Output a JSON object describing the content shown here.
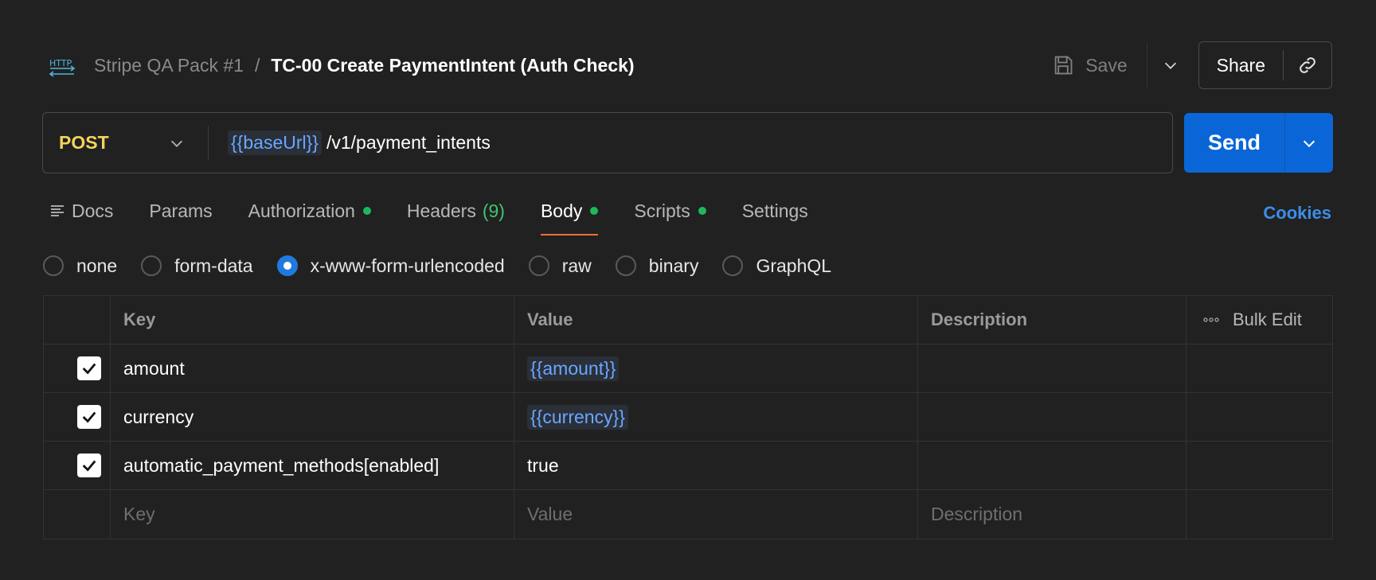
{
  "header": {
    "http_icon": "http-icon",
    "collection": "Stripe QA Pack #1",
    "separator": "/",
    "title": "TC-00 Create PaymentIntent (Auth Check)",
    "save_label": "Save",
    "share_label": "Share"
  },
  "request": {
    "method": "POST",
    "url_variable": "{{baseUrl}}",
    "url_path": "/v1/payment_intents",
    "send_label": "Send"
  },
  "tabs": {
    "docs": "Docs",
    "params": "Params",
    "authorization": "Authorization",
    "headers": "Headers",
    "headers_count": "(9)",
    "body": "Body",
    "scripts": "Scripts",
    "settings": "Settings",
    "active": "Body",
    "cookies": "Cookies"
  },
  "body_types": {
    "none": "none",
    "form_data": "form-data",
    "urlencoded": "x-www-form-urlencoded",
    "raw": "raw",
    "binary": "binary",
    "graphql": "GraphQL",
    "selected": "x-www-form-urlencoded"
  },
  "table": {
    "headers": {
      "key": "Key",
      "value": "Value",
      "description": "Description",
      "bulk_edit": "Bulk Edit"
    },
    "rows": [
      {
        "key": "amount",
        "value": "{{amount}}",
        "checked": true
      },
      {
        "key": "currency",
        "value": "{{currency}}",
        "checked": true
      },
      {
        "key": "automatic_payment_methods[enabled]",
        "value": "true",
        "checked": true
      }
    ],
    "placeholders": {
      "key": "Key",
      "value": "Value",
      "description": "Description"
    }
  },
  "colors": {
    "background": "#212121",
    "method": "#f3d35c",
    "send": "#0a66d6",
    "variable": "#6aa7ff",
    "active_tab_underline": "#f26b3a",
    "status_dot": "#1eb85a",
    "cookies_link": "#3b8eea"
  }
}
